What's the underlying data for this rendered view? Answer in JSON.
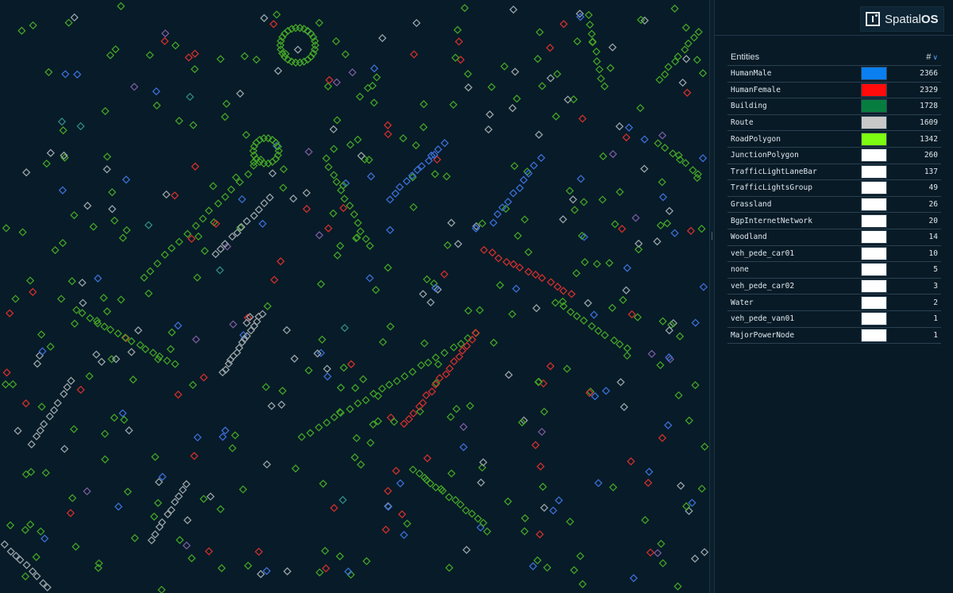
{
  "brand": {
    "name_regular": "Spatial",
    "name_bold": "OS",
    "logo_icon": "spatialos-logo-icon"
  },
  "legend": {
    "column_name": "Entities",
    "column_count": "#",
    "sort_icon": "chevron-down-icon",
    "rows": [
      {
        "name": "HumanMale",
        "color": "#0a7ff0",
        "count": "2366"
      },
      {
        "name": "HumanFemale",
        "color": "#ff0b0b",
        "count": "2329"
      },
      {
        "name": "Building",
        "color": "#067d3f",
        "count": "1728"
      },
      {
        "name": "Route",
        "color": "#c8c8c8",
        "count": "1609"
      },
      {
        "name": "RoadPolygon",
        "color": "#7dfc12",
        "count": "1342"
      },
      {
        "name": "JunctionPolygon",
        "color": "#ffffff",
        "count": "260"
      },
      {
        "name": "TrafficLightLaneBar",
        "color": "#ffffff",
        "count": "137"
      },
      {
        "name": "TrafficLightsGroup",
        "color": "#ffffff",
        "count": "49"
      },
      {
        "name": "Grassland",
        "color": "#ffffff",
        "count": "26"
      },
      {
        "name": "BgpInternetNetwork",
        "color": "#ffffff",
        "count": "20"
      },
      {
        "name": "Woodland",
        "color": "#ffffff",
        "count": "14"
      },
      {
        "name": "veh_pede_car01",
        "color": "#ffffff",
        "count": "10"
      },
      {
        "name": "none",
        "color": "#ffffff",
        "count": "5"
      },
      {
        "name": "veh_pede_car02",
        "color": "#ffffff",
        "count": "3"
      },
      {
        "name": "Water",
        "color": "#ffffff",
        "count": "2"
      },
      {
        "name": "veh_pede_van01",
        "color": "#ffffff",
        "count": "1"
      },
      {
        "name": "MajorPowerNode",
        "color": "#ffffff",
        "count": "1"
      }
    ]
  },
  "map_colors": {
    "green": "#43a326",
    "grey": "#9aa3a8",
    "blue": "#3b6fd6",
    "red": "#d0302d",
    "purple": "#7a5a9e",
    "teal": "#2f8c86"
  }
}
